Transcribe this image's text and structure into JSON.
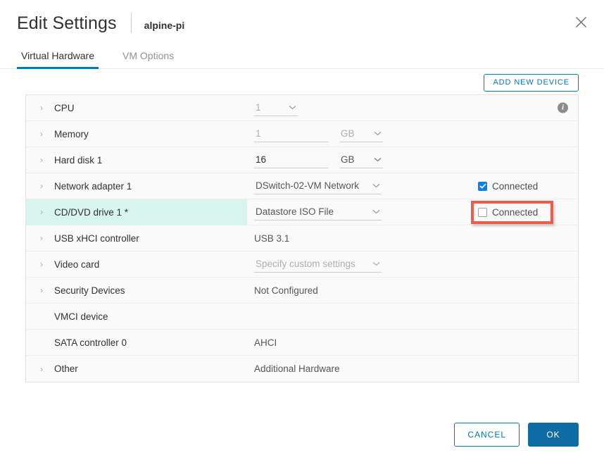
{
  "header": {
    "title": "Edit Settings",
    "object_name": "alpine-pi",
    "close_icon": "close-icon"
  },
  "tabs": [
    {
      "label": "Virtual Hardware",
      "active": true
    },
    {
      "label": "VM Options",
      "active": false
    }
  ],
  "toolbar": {
    "add_device_label": "ADD NEW DEVICE"
  },
  "colors": {
    "accent_blue": "#0079b8",
    "primary_button": "#0f6ba4",
    "checkbox_checked": "#0d7ee6",
    "row_highlight": "#d7f4ef",
    "annotation_red": "#f05b4a",
    "table_bg": "#fafafa",
    "border": "#e3e3e3"
  },
  "table": {
    "rows": [
      {
        "label": "CPU",
        "expandable": true,
        "value_type": "select",
        "value": "1",
        "disabled": true,
        "info_icon": "info-icon"
      },
      {
        "label": "Memory",
        "expandable": true,
        "value_type": "input-unit",
        "value": "1",
        "unit": "GB",
        "disabled": true
      },
      {
        "label": "Hard disk 1",
        "expandable": true,
        "value_type": "input-unit",
        "value": "16",
        "unit": "GB",
        "disabled": false
      },
      {
        "label": "Network adapter 1",
        "expandable": true,
        "value_type": "select-wide",
        "value": "DSwitch-02-VM Network",
        "disabled": false,
        "connected_label": "Connected",
        "connected_checked": true
      },
      {
        "label": "CD/DVD drive 1 *",
        "expandable": true,
        "value_type": "select-wide",
        "value": "Datastore ISO File",
        "disabled": false,
        "connected_label": "Connected",
        "connected_checked": false,
        "highlighted": true,
        "annotated": true
      },
      {
        "label": "USB xHCI controller",
        "expandable": true,
        "value_type": "text",
        "value": "USB 3.1"
      },
      {
        "label": "Video card",
        "expandable": true,
        "value_type": "select-wide",
        "value": "Specify custom settings",
        "disabled": true
      },
      {
        "label": "Security Devices",
        "expandable": true,
        "value_type": "text",
        "value": "Not Configured"
      },
      {
        "label": "VMCI device",
        "expandable": false,
        "value_type": "text",
        "value": ""
      },
      {
        "label": "SATA controller 0",
        "expandable": false,
        "value_type": "text",
        "value": "AHCI"
      },
      {
        "label": "Other",
        "expandable": true,
        "value_type": "text",
        "value": "Additional Hardware"
      }
    ]
  },
  "footer": {
    "cancel_label": "CANCEL",
    "ok_label": "OK"
  }
}
